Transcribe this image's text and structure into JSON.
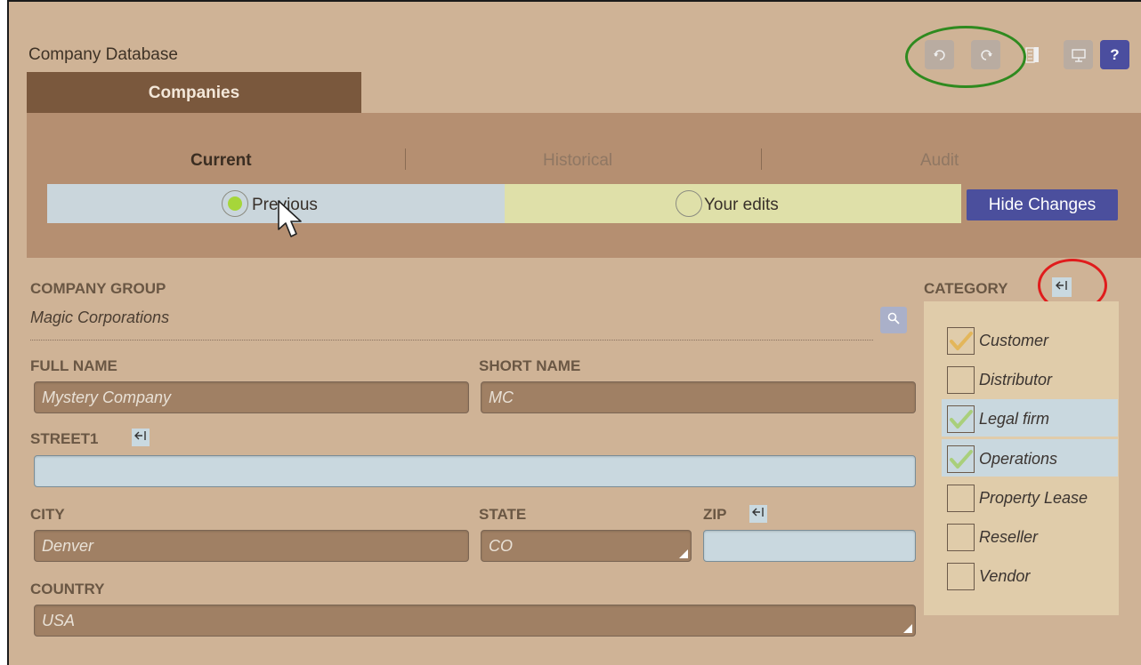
{
  "app": {
    "title": "Company Database"
  },
  "main_tab": {
    "label": "Companies"
  },
  "subtabs": {
    "current": "Current",
    "historical": "Historical",
    "audit": "Audit"
  },
  "compare": {
    "previous_label": "Previous",
    "edits_label": "Your edits",
    "hide_changes_label": "Hide Changes",
    "selected": "Previous"
  },
  "toolbar": {
    "icons": [
      "undo-icon",
      "redo-icon",
      "columns-icon",
      "presentation-icon",
      "help-icon"
    ],
    "help_label": "?"
  },
  "form": {
    "company_group": {
      "label": "COMPANY GROUP",
      "value": "Magic Corporations"
    },
    "full_name": {
      "label": "FULL NAME",
      "value": "Mystery Company"
    },
    "short_name": {
      "label": "SHORT NAME",
      "value": "MC"
    },
    "street1": {
      "label": "STREET1",
      "value": ""
    },
    "city": {
      "label": "CITY",
      "value": "Denver"
    },
    "state": {
      "label": "STATE",
      "value": "CO"
    },
    "zip": {
      "label": "ZIP",
      "value": ""
    },
    "country": {
      "label": "COUNTRY",
      "value": "USA"
    }
  },
  "category": {
    "label": "CATEGORY",
    "items": [
      {
        "label": "Customer",
        "checked": true,
        "highlighted": false
      },
      {
        "label": "Distributor",
        "checked": false,
        "highlighted": false
      },
      {
        "label": "Legal firm",
        "checked": true,
        "highlighted": true
      },
      {
        "label": "Operations",
        "checked": true,
        "highlighted": true
      },
      {
        "label": "Property Lease",
        "checked": false,
        "highlighted": false
      },
      {
        "label": "Reseller",
        "checked": false,
        "highlighted": false
      },
      {
        "label": "Vendor",
        "checked": false,
        "highlighted": false
      }
    ]
  },
  "colors": {
    "accent": "#4b4f9d",
    "tab": "#7a583d",
    "background": "#cfb396",
    "check_customer": "#e3b65a",
    "check_other": "#a9cf7b"
  }
}
